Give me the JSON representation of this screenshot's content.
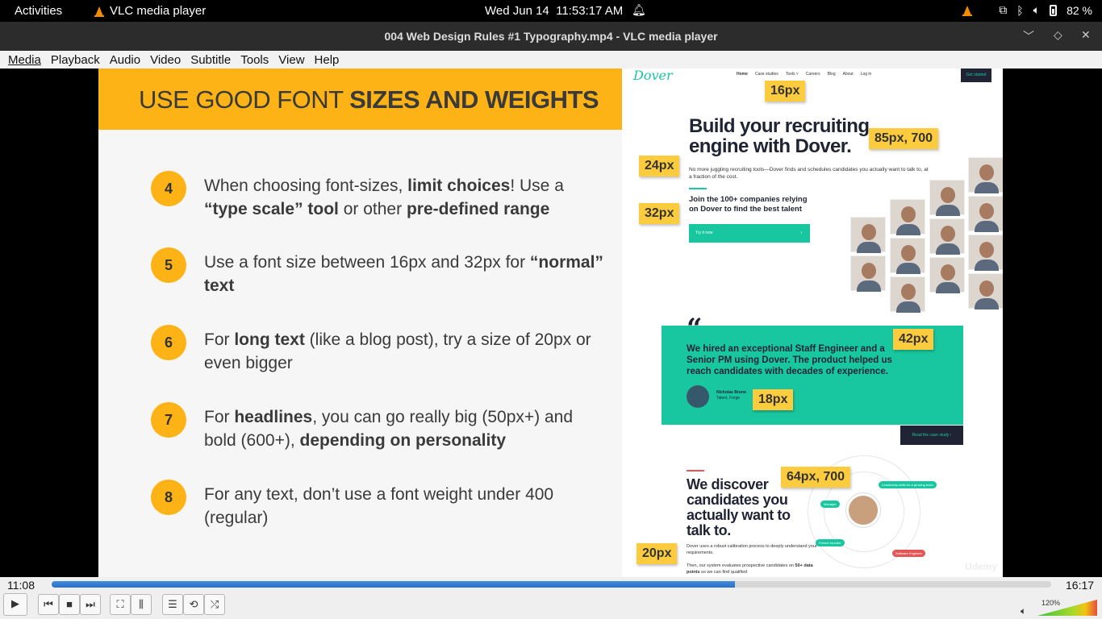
{
  "topbar": {
    "activities": "Activities",
    "app_name": "VLC media player",
    "clock": "Wed Jun 14  11:53:17 AM",
    "battery": "82 %"
  },
  "window": {
    "title": "004 Web Design Rules #1 Typography.mp4 - VLC media player"
  },
  "menu": [
    "Media",
    "Playback",
    "Audio",
    "Video",
    "Subtitle",
    "Tools",
    "View",
    "Help"
  ],
  "slide": {
    "title_regular": "USE GOOD FONT ",
    "title_bold": "SIZES AND WEIGHTS",
    "items": [
      {
        "num": "4",
        "parts": [
          {
            "t": "When choosing font-sizes, "
          },
          {
            "t": "limit choices",
            "b": true
          },
          {
            "t": "! Use a "
          },
          {
            "t": "“type scale” tool",
            "b": true
          },
          {
            "t": " or other "
          },
          {
            "t": "pre-defined range",
            "b": true
          }
        ]
      },
      {
        "num": "5",
        "parts": [
          {
            "t": "Use a font size between 16px and 32px for "
          },
          {
            "t": "“normal” text",
            "b": true
          }
        ]
      },
      {
        "num": "6",
        "parts": [
          {
            "t": "For "
          },
          {
            "t": "long text",
            "b": true
          },
          {
            "t": " (like a blog post), try a size of 20px or even bigger"
          }
        ]
      },
      {
        "num": "7",
        "parts": [
          {
            "t": "For "
          },
          {
            "t": "headlines",
            "b": true
          },
          {
            "t": ", you can go really big (50px+) and bold (600+), "
          },
          {
            "t": "depending on personality",
            "b": true
          }
        ]
      },
      {
        "num": "8",
        "parts": [
          {
            "t": "For any text, don’t use a font weight under 400 (regular)"
          }
        ]
      }
    ]
  },
  "shot": {
    "logo": "Dover",
    "nav": [
      "Home",
      "Case studies",
      "Tools ˅",
      "Careers",
      "Blog",
      "About",
      "Log in"
    ],
    "get_started": "Get started",
    "headline": "Build your recruiting engine with Dover.",
    "sub": "No more juggling recruiting tools—Dover finds and schedules candidates you actually want to talk to, at a fraction of the cost.",
    "join": "Join the 100+ companies relying on Dover to find the best talent",
    "try": "Try it now",
    "quote": "We hired an exceptional Staff Engineer and a Senior PM using Dover. The product helped us reach candidates with decades of experience.",
    "nick_name": "Nicholas Bruno",
    "nick_role": "Talent, Forge",
    "read_case": "Read the case study ›",
    "discover": "We discover candidates you actually want to talk to.",
    "discover_sub1": "Dover uses a robust calibration process to deeply understand your requirements.",
    "discover_sub2_a": "Then, our system evaluates prospective candidates on ",
    "discover_sub2_b": "50+ data points",
    "discover_sub2_c": " so we can find qualified",
    "pills": [
      "Leadership skills for a growing team",
      "Manager",
      "Former founder",
      "Software Engineer"
    ],
    "watermark": "Udemy",
    "tags": {
      "t16": "16px",
      "t85": "85px, 700",
      "t24": "24px",
      "t32": "32px",
      "t42": "42px",
      "t18": "18px",
      "t64": "64px, 700",
      "t20": "20px"
    }
  },
  "player": {
    "elapsed": "11:08",
    "total": "16:17",
    "progress_fraction": 0.684,
    "volume_label": "120%",
    "volume_fraction": 1.0
  },
  "colors": {
    "accent_orange": "#fdb316",
    "teal": "#18c7a0",
    "navy": "#1f2333",
    "seek_blue": "#2a6fc5"
  }
}
